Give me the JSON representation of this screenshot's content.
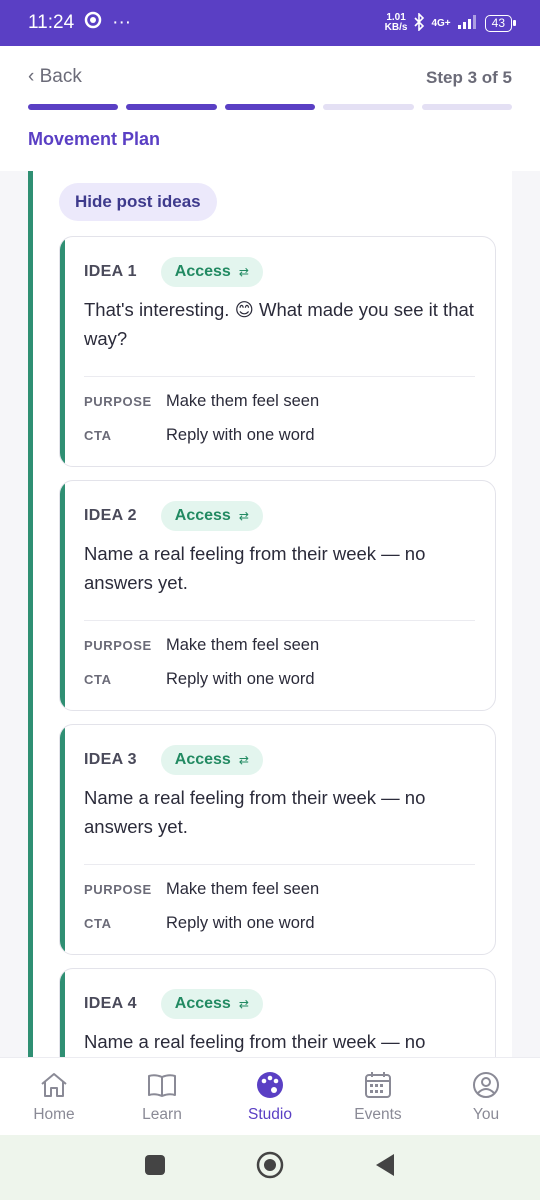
{
  "status_bar": {
    "time": "11:24",
    "dots": "···",
    "net_speed_value": "1.01",
    "net_speed_unit": "KB/s",
    "network": "4G+",
    "battery": "43"
  },
  "header": {
    "back_label": "‹ Back",
    "step_label": "Step 3 of 5",
    "progress": {
      "current": 3,
      "total": 5
    },
    "section_title": "Movement Plan"
  },
  "main": {
    "hide_button_label": "Hide post ideas",
    "ideas": [
      {
        "label": "IDEA 1",
        "badge": "Access",
        "text": "That's interesting. 😊 What made you see it that way?",
        "purpose_key": "PURPOSE",
        "purpose": "Make them feel seen",
        "cta_key": "CTA",
        "cta": "Reply with one word"
      },
      {
        "label": "IDEA 2",
        "badge": "Access",
        "text": "Name a real feeling from their week — no answers yet.",
        "purpose_key": "PURPOSE",
        "purpose": "Make them feel seen",
        "cta_key": "CTA",
        "cta": "Reply with one word"
      },
      {
        "label": "IDEA 3",
        "badge": "Access",
        "text": "Name a real feeling from their week — no answers yet.",
        "purpose_key": "PURPOSE",
        "purpose": "Make them feel seen",
        "cta_key": "CTA",
        "cta": "Reply with one word"
      },
      {
        "label": "IDEA 4",
        "badge": "Access",
        "text": "Name a real feeling from their week — no answers yet."
      }
    ]
  },
  "bottom_nav": {
    "items": [
      {
        "label": "Home",
        "icon": "home-icon"
      },
      {
        "label": "Learn",
        "icon": "book-icon"
      },
      {
        "label": "Studio",
        "icon": "palette-icon",
        "active": true
      },
      {
        "label": "Events",
        "icon": "calendar-icon"
      },
      {
        "label": "You",
        "icon": "profile-icon"
      }
    ]
  },
  "colors": {
    "brand": "#5a3fc4",
    "accent_green": "#2f8f73",
    "badge_bg": "#e3f5ee"
  }
}
